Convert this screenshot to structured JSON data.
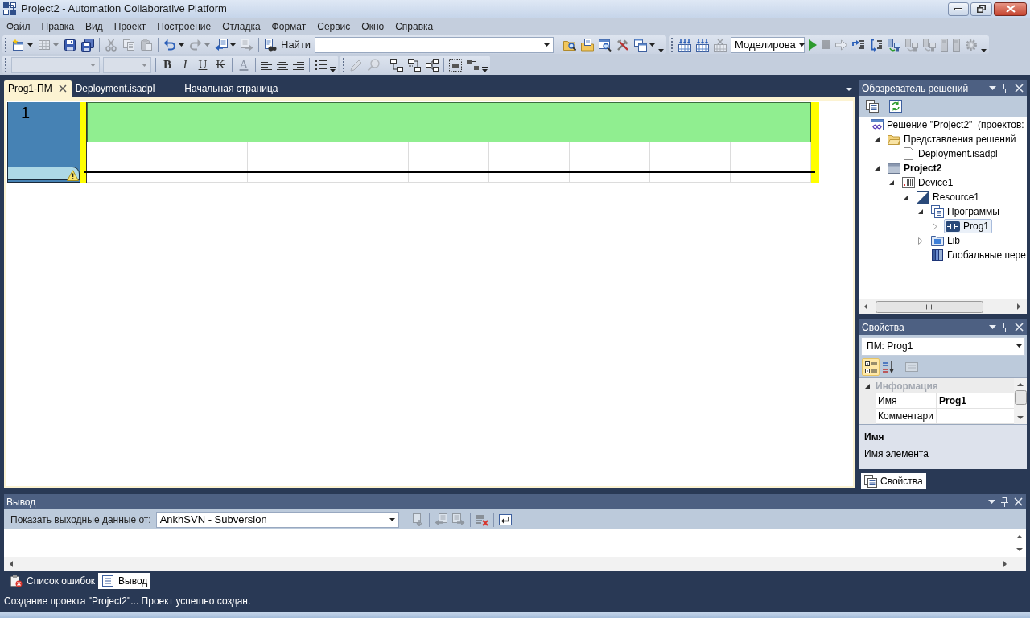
{
  "window": {
    "title": "Project2 - Automation Collaborative Platform"
  },
  "menu": [
    "Файл",
    "Правка",
    "Вид",
    "Проект",
    "Построение",
    "Отладка",
    "Формат",
    "Сервис",
    "Окно",
    "Справка"
  ],
  "toolbars": [
    [
      {
        "items": [
          {
            "kind": "button",
            "disabled": false,
            "dropdown": true
          },
          {
            "kind": "button",
            "disabled": true,
            "dropdown": true
          },
          {
            "kind": "button",
            "disabled": false
          },
          {
            "kind": "button",
            "disabled": false
          },
          {
            "kind": "separator"
          },
          {
            "kind": "button",
            "disabled": true
          },
          {
            "kind": "button",
            "disabled": true
          },
          {
            "kind": "button",
            "disabled": true
          },
          {
            "kind": "separator"
          },
          {
            "kind": "button",
            "disabled": false,
            "dropdown": true
          },
          {
            "kind": "button",
            "disabled": true,
            "dropdown": true
          },
          {
            "kind": "button",
            "disabled": false,
            "dropdown": true
          },
          {
            "kind": "button",
            "disabled": true
          },
          {
            "kind": "separator"
          },
          {
            "kind": "button",
            "label": "Найти",
            "disabled": false
          },
          {
            "kind": "combo",
            "disabled": false
          },
          {
            "kind": "separator"
          },
          {
            "kind": "button",
            "disabled": false
          },
          {
            "kind": "button",
            "disabled": false
          },
          {
            "kind": "button",
            "disabled": false
          },
          {
            "kind": "button",
            "disabled": false
          },
          {
            "kind": "button",
            "disabled": false,
            "dropdown": true
          },
          {
            "kind": "overflow"
          }
        ]
      },
      {
        "items": [
          {
            "kind": "button",
            "disabled": false
          },
          {
            "kind": "button",
            "disabled": false
          },
          {
            "kind": "button",
            "disabled": true
          },
          {
            "kind": "combo",
            "value": "Моделирова",
            "disabled": false
          },
          {
            "kind": "button",
            "disabled": false
          },
          {
            "kind": "button",
            "disabled": true
          },
          {
            "kind": "button",
            "disabled": true
          },
          {
            "kind": "button",
            "disabled": false
          },
          {
            "kind": "button",
            "disabled": false
          },
          {
            "kind": "button",
            "disabled": false
          },
          {
            "kind": "button",
            "disabled": true
          },
          {
            "kind": "button",
            "disabled": true
          },
          {
            "kind": "button",
            "disabled": true
          },
          {
            "kind": "button",
            "disabled": true
          },
          {
            "kind": "button",
            "disabled": true
          },
          {
            "kind": "overflow"
          }
        ]
      }
    ],
    [
      {
        "items": [
          {
            "kind": "combo",
            "disabled": true
          },
          {
            "kind": "combo",
            "disabled": true
          },
          {
            "kind": "separator"
          },
          {
            "kind": "format",
            "label": "B",
            "disabled": false
          },
          {
            "kind": "format",
            "label": "I",
            "disabled": false
          },
          {
            "kind": "format",
            "label": "U",
            "disabled": false
          },
          {
            "kind": "format",
            "label": "K",
            "disabled": false
          },
          {
            "kind": "separator"
          },
          {
            "kind": "format",
            "label": "A",
            "disabled": true
          },
          {
            "kind": "separator"
          },
          {
            "kind": "button",
            "disabled": false
          },
          {
            "kind": "button",
            "disabled": false
          },
          {
            "kind": "button",
            "disabled": false
          },
          {
            "kind": "separator"
          },
          {
            "kind": "button",
            "disabled": false
          },
          {
            "kind": "overflow"
          }
        ]
      },
      {
        "items": [
          {
            "kind": "button",
            "disabled": true
          },
          {
            "kind": "button",
            "disabled": true
          },
          {
            "kind": "separator"
          },
          {
            "kind": "button",
            "disabled": false
          },
          {
            "kind": "button",
            "disabled": false
          },
          {
            "kind": "button",
            "disabled": false
          },
          {
            "kind": "separator"
          },
          {
            "kind": "button",
            "disabled": false
          },
          {
            "kind": "button",
            "disabled": false
          },
          {
            "kind": "overflow"
          }
        ]
      }
    ]
  ],
  "document_tabs": [
    {
      "label": "Prog1-ПМ",
      "selected": true
    },
    {
      "label": "Deployment.isadpl",
      "selected": false
    },
    {
      "label": "Начальная страница",
      "selected": false
    }
  ],
  "editor": {
    "rungs": [
      {
        "number": "1",
        "warning": true
      }
    ]
  },
  "solution_explorer": {
    "title": "Обозреватель решений",
    "toolbar": [
      {
        "kind": "button",
        "disabled": false
      },
      {
        "kind": "separator"
      },
      {
        "kind": "button",
        "disabled": false
      }
    ],
    "tree": [
      {
        "label": "Решение \"Project2\"  (проектов:",
        "selected": false,
        "children": [
          {
            "label": "Представления решений",
            "expanded": true,
            "selected": false,
            "children": [
              {
                "label": "Deployment.isadpl",
                "selected": false
              }
            ]
          },
          {
            "label": "Project2",
            "expanded": true,
            "selected": false,
            "startup": true,
            "children": [
              {
                "label": "Device1",
                "expanded": true,
                "selected": false,
                "children": [
                  {
                    "label": "Resource1",
                    "expanded": true,
                    "selected": false,
                    "children": [
                      {
                        "label": "Программы",
                        "expanded": true,
                        "selected": false,
                        "children": [
                          {
                            "label": "Prog1",
                            "expanded": false,
                            "selected": true
                          }
                        ]
                      },
                      {
                        "label": "Lib",
                        "expanded": false,
                        "selected": false
                      },
                      {
                        "label": "Глобальные пере",
                        "selected": false
                      }
                    ]
                  }
                ]
              }
            ]
          }
        ]
      }
    ]
  },
  "properties": {
    "title": "Свойства",
    "object": "ПМ: Prog1",
    "toolbar": [
      {
        "kind": "toggle",
        "selected": true
      },
      {
        "kind": "toggle",
        "selected": false
      },
      {
        "kind": "separator"
      },
      {
        "kind": "button",
        "disabled": true
      }
    ],
    "categories": [
      {
        "label": "Информация",
        "expanded": true,
        "rows": [
          {
            "name": "Имя",
            "value": "Prog1"
          },
          {
            "name": "Комментари"
          }
        ]
      }
    ],
    "description": {
      "title": "Имя",
      "text": "Имя элемента"
    },
    "tabs": [
      {
        "label": "Свойства",
        "selected": true
      }
    ]
  },
  "output": {
    "title": "Вывод",
    "source_label": "Показать выходные данные от:",
    "source": "AnkhSVN - Subversion",
    "toolbar": [
      {
        "kind": "button",
        "disabled": true
      },
      {
        "kind": "separator"
      },
      {
        "kind": "button",
        "disabled": true
      },
      {
        "kind": "button",
        "disabled": true
      },
      {
        "kind": "separator"
      },
      {
        "kind": "button",
        "disabled": false
      },
      {
        "kind": "separator"
      },
      {
        "kind": "button",
        "disabled": false
      }
    ]
  },
  "bottom_tabs": [
    {
      "label": "Список ошибок",
      "selected": false
    },
    {
      "label": "Вывод",
      "selected": true
    }
  ],
  "status_bar": "Создание проекта \"Project2\"... Проект успешно создан."
}
